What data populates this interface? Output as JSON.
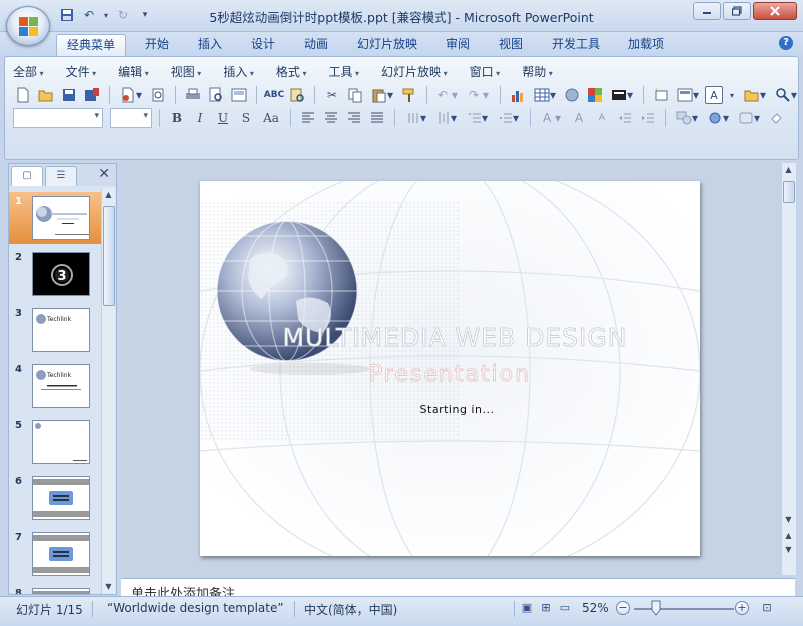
{
  "window": {
    "title": "5秒超炫动画倒计时ppt模板.ppt [兼容模式] - Microsoft PowerPoint",
    "minimize_label": "▭",
    "restore_label": "◻",
    "close_label": "✕"
  },
  "ribbon_tabs": [
    {
      "label": "经典菜单",
      "active": true
    },
    {
      "label": "开始"
    },
    {
      "label": "插入"
    },
    {
      "label": "设计"
    },
    {
      "label": "动画"
    },
    {
      "label": "幻灯片放映"
    },
    {
      "label": "审阅"
    },
    {
      "label": "视图"
    },
    {
      "label": "开发工具"
    },
    {
      "label": "加载项"
    }
  ],
  "classic_menu": [
    "全部",
    "文件",
    "编辑",
    "视图",
    "插入",
    "格式",
    "工具",
    "幻灯片放映",
    "窗口",
    "帮助"
  ],
  "format_buttons": [
    "B",
    "I",
    "U",
    "S",
    "Aa"
  ],
  "font_color_box": "A",
  "slide_pane": {
    "thumbnails": [
      {
        "number": "1",
        "selected": true
      },
      {
        "number": "2"
      },
      {
        "number": "3"
      },
      {
        "number": "4"
      },
      {
        "number": "5"
      },
      {
        "number": "6"
      },
      {
        "number": "7"
      },
      {
        "number": "8"
      }
    ]
  },
  "slide": {
    "heading": "MULTIMEDIA WEB DESIGN",
    "subheading": "Presentation",
    "tagline": "Starting in...",
    "thumb2_digit": "3",
    "thumb_logo": "Techlink"
  },
  "notes_placeholder": "单击此处添加备注",
  "status": {
    "slide_indicator": "幻灯片 1/15",
    "theme": "“Worldwide design template”",
    "language": "中文(简体，中国)",
    "zoom": "52%"
  }
}
